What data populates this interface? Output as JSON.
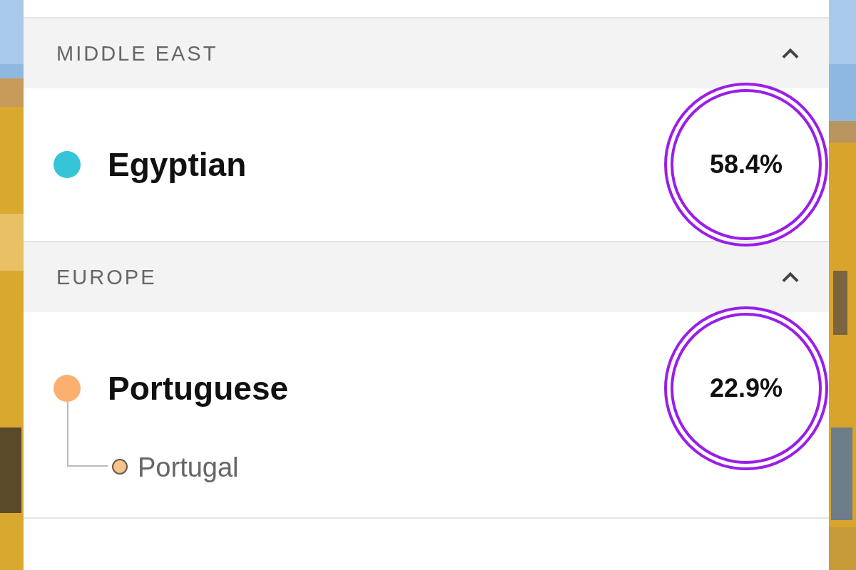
{
  "sections": [
    {
      "title": "MIDDLE EAST",
      "expanded": true,
      "items": [
        {
          "name": "Egyptian",
          "color": "#36c5d8",
          "percent": "58.4%",
          "circled": true
        }
      ]
    },
    {
      "title": "EUROPE",
      "expanded": true,
      "items": [
        {
          "name": "Portuguese",
          "color": "#fbb070",
          "percent": "22.9%",
          "circled": true,
          "children": [
            {
              "name": "Portugal",
              "color": "#f8c48e"
            }
          ]
        }
      ]
    }
  ]
}
